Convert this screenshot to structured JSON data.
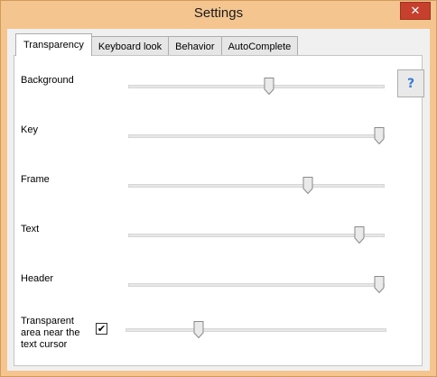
{
  "window": {
    "title": "Settings",
    "close_label": "✕"
  },
  "tabs": [
    {
      "label": "Transparency",
      "active": true
    },
    {
      "label": "Keyboard look",
      "active": false
    },
    {
      "label": "Behavior",
      "active": false
    },
    {
      "label": "AutoComplete",
      "active": false
    }
  ],
  "help_button": {
    "label": "?"
  },
  "sliders": [
    {
      "label": "Background",
      "level": 0.55
    },
    {
      "label": "Key",
      "level": 1.0
    },
    {
      "label": "Frame",
      "level": 0.71
    },
    {
      "label": "Text",
      "level": 0.92
    },
    {
      "label": "Header",
      "level": 1.0
    }
  ],
  "cursor_option": {
    "label": "Transparent area near the text cursor",
    "checked": true,
    "check_mark": "✔",
    "level": 0.27
  }
}
